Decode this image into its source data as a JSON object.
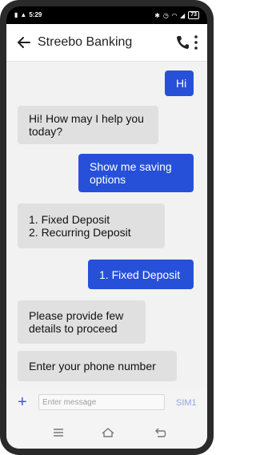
{
  "status": {
    "time": "5:29",
    "battery": "73"
  },
  "header": {
    "title": "Streebo Banking"
  },
  "messages": [
    {
      "sender": "user",
      "text": "Hi"
    },
    {
      "sender": "bot",
      "text": "Hi! How may I help you\ntoday?"
    },
    {
      "sender": "user",
      "text": "Show me saving\noptions"
    },
    {
      "sender": "bot",
      "text": "1. Fixed Deposit\n2. Recurring Deposit"
    },
    {
      "sender": "user",
      "text": "1. Fixed Deposit"
    },
    {
      "sender": "bot",
      "text": "Please provide few\ndetails to proceed"
    },
    {
      "sender": "bot",
      "text": "Enter your phone number"
    }
  ],
  "composer": {
    "placeholder": "Enter message",
    "sim_label": "SIM1"
  },
  "colors": {
    "user_bubble": "#2750d9",
    "bot_bubble": "#e0e0e0",
    "accent": "#3a5bd9"
  },
  "icons": {
    "back": "arrow-left-icon",
    "call": "phone-icon",
    "menu": "kebab-menu-icon",
    "add": "plus-icon",
    "nav_recent": "menu-lines-icon",
    "nav_home": "home-icon",
    "nav_back": "back-return-icon"
  }
}
